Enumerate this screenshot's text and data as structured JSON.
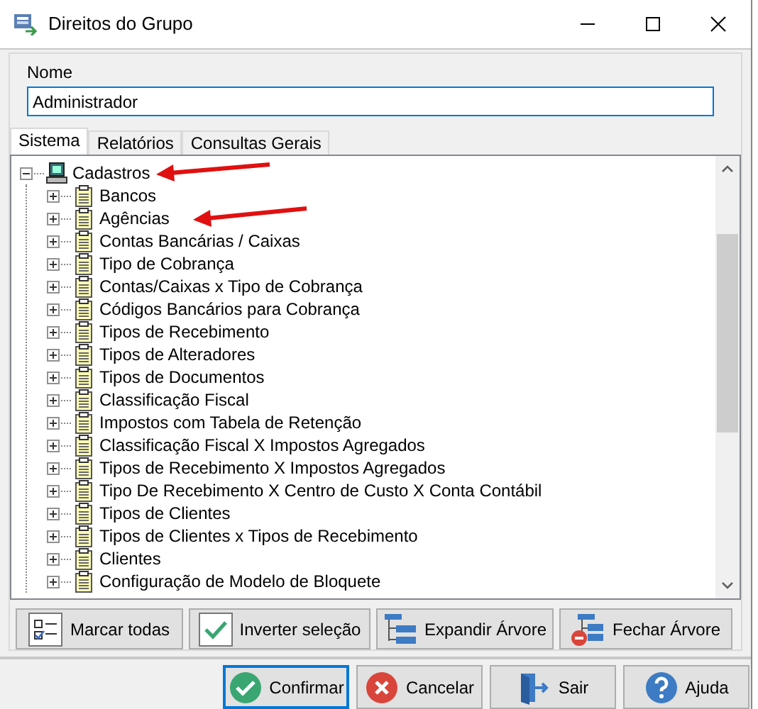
{
  "window": {
    "title": "Direitos do Grupo"
  },
  "name_field": {
    "label": "Nome",
    "value": "Administrador"
  },
  "tabs": [
    {
      "label": "Sistema",
      "selected": true
    },
    {
      "label": "Relatórios",
      "selected": false
    },
    {
      "label": "Consultas Gerais",
      "selected": false
    }
  ],
  "tree": [
    {
      "label": "Cadastros",
      "kind": "computer",
      "expanded": true,
      "children": [
        {
          "label": "Bancos",
          "kind": "form",
          "expanded": false
        },
        {
          "label": "Agências",
          "kind": "form",
          "expanded": false
        },
        {
          "label": "Contas Bancárias / Caixas",
          "kind": "form",
          "expanded": false
        },
        {
          "label": "Tipo de Cobrança",
          "kind": "form",
          "expanded": false
        },
        {
          "label": "Contas/Caixas x Tipo de Cobrança",
          "kind": "form",
          "expanded": false
        },
        {
          "label": "Códigos Bancários para Cobrança",
          "kind": "form",
          "expanded": false
        },
        {
          "label": "Tipos de Recebimento",
          "kind": "form",
          "expanded": false
        },
        {
          "label": "Tipos de Alteradores",
          "kind": "form",
          "expanded": false
        },
        {
          "label": "Tipos de Documentos",
          "kind": "form",
          "expanded": false
        },
        {
          "label": "Classificação Fiscal",
          "kind": "form",
          "expanded": false
        },
        {
          "label": "Impostos com Tabela de Retenção",
          "kind": "form",
          "expanded": false
        },
        {
          "label": "Classificação Fiscal X Impostos Agregados",
          "kind": "form",
          "expanded": false
        },
        {
          "label": "Tipos de Recebimento X Impostos Agregados",
          "kind": "form",
          "expanded": false
        },
        {
          "label": "Tipo De Recebimento X Centro de Custo X Conta Contábil",
          "kind": "form",
          "expanded": false
        },
        {
          "label": "Tipos de Clientes",
          "kind": "form",
          "expanded": false
        },
        {
          "label": "Tipos de Clientes x Tipos de Recebimento",
          "kind": "form",
          "expanded": false
        },
        {
          "label": "Clientes",
          "kind": "form",
          "expanded": false
        },
        {
          "label": "Configuração de Modelo de Bloquete",
          "kind": "form",
          "expanded": false
        }
      ]
    }
  ],
  "tree_buttons": [
    {
      "label": "Marcar todas",
      "kind": "check-all"
    },
    {
      "label": "Inverter seleção",
      "kind": "invert"
    },
    {
      "label": "Expandir Árvore",
      "kind": "expand"
    },
    {
      "label": "Fechar Árvore",
      "kind": "collapse"
    }
  ],
  "dialog_buttons": [
    {
      "label": "Confirmar",
      "kind": "confirm",
      "focused": true
    },
    {
      "label": "Cancelar",
      "kind": "cancel",
      "focused": false
    },
    {
      "label": "Sair",
      "kind": "exit",
      "focused": false
    },
    {
      "label": "Ajuda",
      "kind": "help",
      "focused": false
    }
  ]
}
